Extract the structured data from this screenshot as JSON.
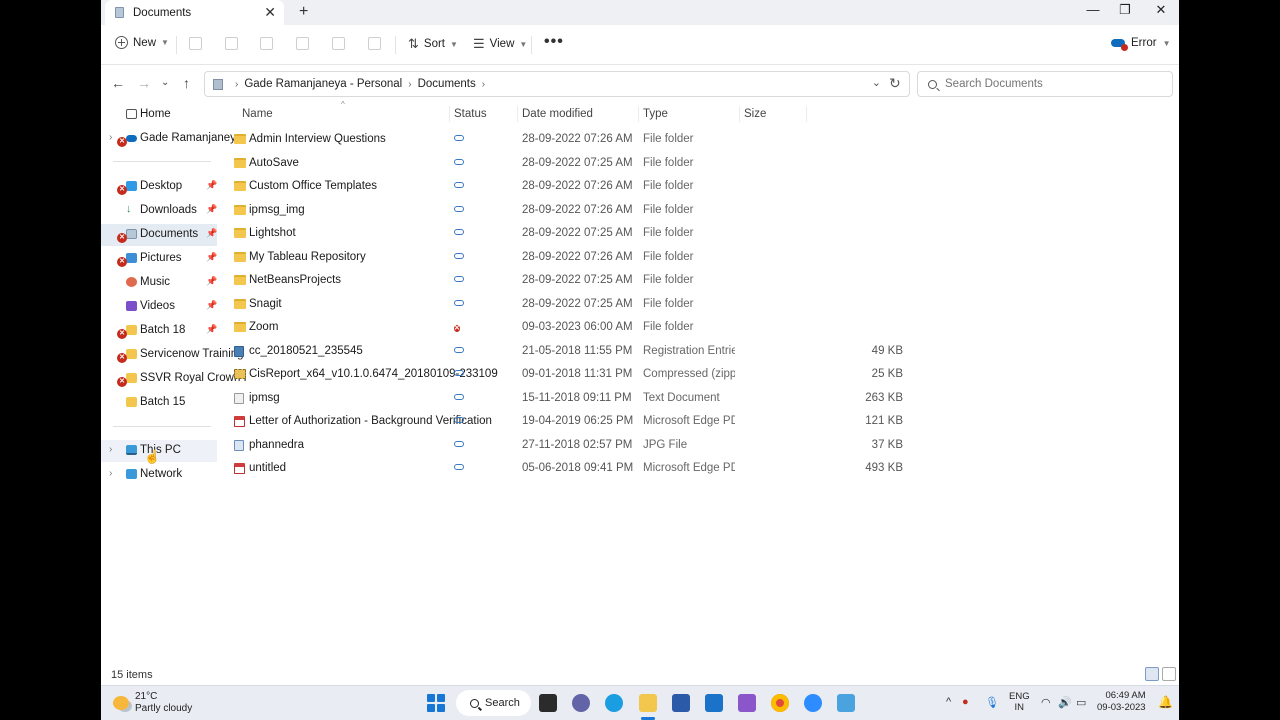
{
  "window": {
    "tab_title": "Documents",
    "close_tab": "✕",
    "new_tab": "+",
    "minimize": "—",
    "maximize": "❐",
    "close": "✕"
  },
  "toolbar": {
    "new_label": "New",
    "sort_label": "Sort",
    "view_label": "View",
    "more": "•••",
    "error_label": "Error"
  },
  "address": {
    "segments": [
      "Gade Ramanjaneya - Personal",
      "Documents"
    ],
    "search_placeholder": "Search Documents"
  },
  "sidebar": {
    "items": [
      {
        "label": "Home",
        "icon": "home-icon"
      },
      {
        "label": "Gade Ramanjaneya",
        "icon": "onedrive-icon"
      },
      {
        "label": "Desktop",
        "icon": "desktop-icon"
      },
      {
        "label": "Downloads",
        "icon": "download-icon"
      },
      {
        "label": "Documents",
        "icon": "documents-icon"
      },
      {
        "label": "Pictures",
        "icon": "pictures-icon"
      },
      {
        "label": "Music",
        "icon": "music-icon"
      },
      {
        "label": "Videos",
        "icon": "videos-icon"
      },
      {
        "label": "Batch 18",
        "icon": "folder-icon"
      },
      {
        "label": "Servicenow Training",
        "icon": "folder-icon"
      },
      {
        "label": "SSVR Royal Crown I",
        "icon": "folder-icon"
      },
      {
        "label": "Batch 15",
        "icon": "folder-icon"
      },
      {
        "label": "This PC",
        "icon": "pc-icon"
      },
      {
        "label": "Network",
        "icon": "network-icon"
      }
    ]
  },
  "columns": {
    "name": "Name",
    "status": "Status",
    "date": "Date modified",
    "type": "Type",
    "size": "Size"
  },
  "files": [
    {
      "name": "Admin Interview Questions",
      "status": "cloud",
      "date": "28-09-2022 07:26 AM",
      "type": "File folder",
      "size": "",
      "icon": "folder"
    },
    {
      "name": "AutoSave",
      "status": "cloud",
      "date": "28-09-2022 07:25 AM",
      "type": "File folder",
      "size": "",
      "icon": "folder"
    },
    {
      "name": "Custom Office Templates",
      "status": "cloud",
      "date": "28-09-2022 07:26 AM",
      "type": "File folder",
      "size": "",
      "icon": "folder"
    },
    {
      "name": "ipmsg_img",
      "status": "cloud",
      "date": "28-09-2022 07:26 AM",
      "type": "File folder",
      "size": "",
      "icon": "folder"
    },
    {
      "name": "Lightshot",
      "status": "cloud",
      "date": "28-09-2022 07:25 AM",
      "type": "File folder",
      "size": "",
      "icon": "folder"
    },
    {
      "name": "My Tableau Repository",
      "status": "cloud",
      "date": "28-09-2022 07:26 AM",
      "type": "File folder",
      "size": "",
      "icon": "folder"
    },
    {
      "name": "NetBeansProjects",
      "status": "cloud",
      "date": "28-09-2022 07:25 AM",
      "type": "File folder",
      "size": "",
      "icon": "folder"
    },
    {
      "name": "Snagit",
      "status": "cloud",
      "date": "28-09-2022 07:25 AM",
      "type": "File folder",
      "size": "",
      "icon": "folder"
    },
    {
      "name": "Zoom",
      "status": "error",
      "date": "09-03-2023 06:00 AM",
      "type": "File folder",
      "size": "",
      "icon": "folder"
    },
    {
      "name": "cc_20180521_235545",
      "status": "cloud",
      "date": "21-05-2018 11:55 PM",
      "type": "Registration Entries",
      "size": "49 KB",
      "icon": "reg"
    },
    {
      "name": "CisReport_x64_v10.1.0.6474_20180109-233109",
      "status": "cloud",
      "date": "09-01-2018 11:31 PM",
      "type": "Compressed (zipped)...",
      "size": "25 KB",
      "icon": "zip"
    },
    {
      "name": "ipmsg",
      "status": "cloud",
      "date": "15-11-2018 09:11 PM",
      "type": "Text Document",
      "size": "263 KB",
      "icon": "txt"
    },
    {
      "name": "Letter of Authorization - Background Verification",
      "status": "cloud",
      "date": "19-04-2019 06:25 PM",
      "type": "Microsoft Edge PDF ...",
      "size": "121 KB",
      "icon": "pdf"
    },
    {
      "name": "phannedra",
      "status": "cloud",
      "date": "27-11-2018 02:57 PM",
      "type": "JPG File",
      "size": "37 KB",
      "icon": "jpg"
    },
    {
      "name": "untitled",
      "status": "cloud",
      "date": "05-06-2018 09:41 PM",
      "type": "Microsoft Edge PDF ...",
      "size": "493 KB",
      "icon": "pdf"
    }
  ],
  "statusbar": {
    "count": "15 items"
  },
  "taskbar": {
    "temp": "21°C",
    "weather": "Partly cloudy",
    "search_label": "Search",
    "lang_top": "ENG",
    "lang_bottom": "IN",
    "time": "06:49 AM",
    "date": "09-03-2023"
  },
  "colors": {
    "accent": "#1677d6",
    "error": "#c42b1c",
    "cloud": "#3a78c2",
    "folder": "#f3c74d",
    "selected": "#e5ebf3"
  }
}
